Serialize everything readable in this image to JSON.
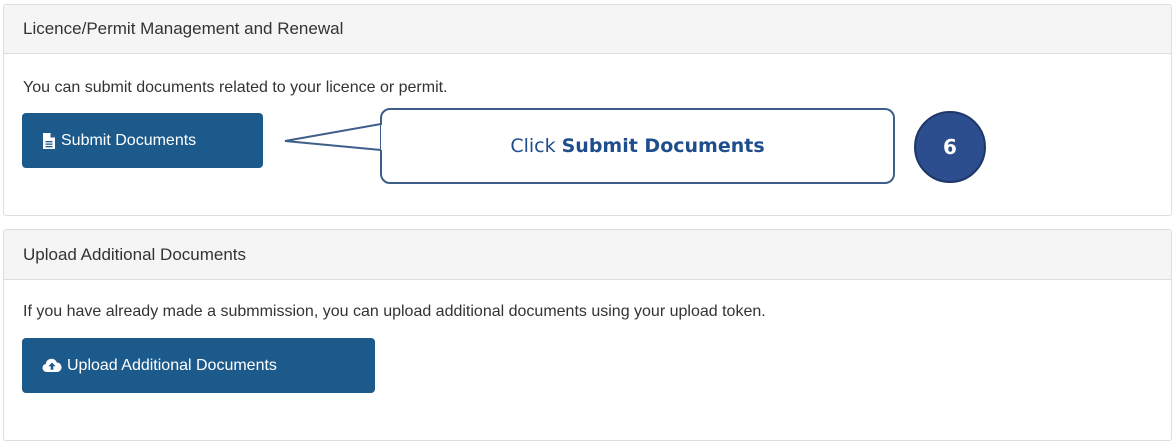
{
  "licence_panel": {
    "title": "Licence/Permit Management and Renewal",
    "description": "You can submit documents related to your licence or permit.",
    "submit_button_label": "Submit Documents",
    "submit_icon": "file-icon"
  },
  "upload_panel": {
    "title": "Upload Additional Documents",
    "description": "If you have already made a submmission, you can upload additional documents using your upload token.",
    "upload_button_label": "Upload Additional Documents",
    "upload_icon": "cloud-upload-icon"
  },
  "callout": {
    "prefix": "Click",
    "emphasis": "Submit Documents"
  },
  "step_badge": {
    "number": "6"
  },
  "colors": {
    "button_bg": "#1d5a8c",
    "callout_border": "#3e5f8a",
    "callout_text": "#1f4e8c",
    "badge_bg": "#2d4e8e"
  }
}
